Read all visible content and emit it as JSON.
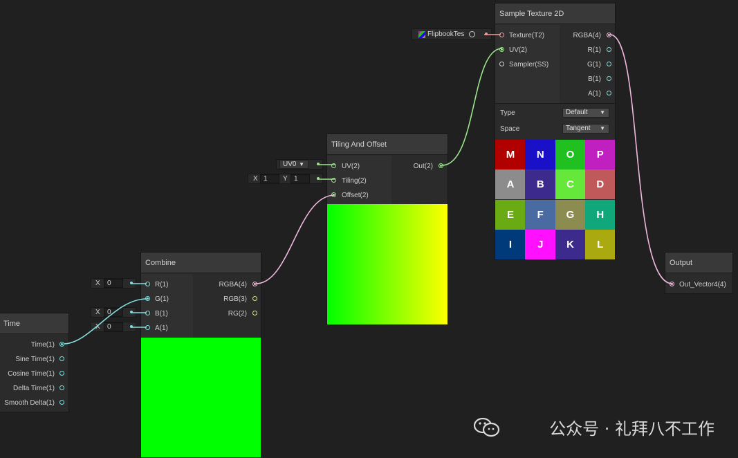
{
  "nodes": {
    "time": {
      "title": "Time",
      "outputs": [
        "Time(1)",
        "Sine Time(1)",
        "Cosine Time(1)",
        "Delta Time(1)",
        "Smooth Delta(1)"
      ]
    },
    "combine": {
      "title": "Combine",
      "inputs": [
        "R(1)",
        "G(1)",
        "B(1)",
        "A(1)"
      ],
      "outputs": [
        "RGBA(4)",
        "RGB(3)",
        "RG(2)"
      ],
      "field_axis": "X",
      "r_value": "0",
      "b_value": "0",
      "a_value": "0",
      "preview_color": "#00ff00"
    },
    "tiling": {
      "title": "Tiling And Offset",
      "inputs": [
        "UV(2)",
        "Tiling(2)",
        "Offset(2)"
      ],
      "outputs": [
        "Out(2)"
      ],
      "uv_channel": "UV0",
      "tiling_x_label": "X",
      "tiling_x": "1",
      "tiling_y_label": "Y",
      "tiling_y": "1"
    },
    "sample": {
      "title": "Sample Texture 2D",
      "inputs": [
        "Texture(T2)",
        "UV(2)",
        "Sampler(SS)"
      ],
      "outputs": [
        "RGBA(4)",
        "R(1)",
        "G(1)",
        "B(1)",
        "A(1)"
      ],
      "type_label": "Type",
      "type_value": "Default",
      "space_label": "Space",
      "space_value": "Tangent",
      "texture_asset": "FlipbookTes"
    },
    "output": {
      "title": "Output",
      "inputs": [
        "Out_Vector4(4)"
      ]
    }
  },
  "flipbook_letters": [
    "M",
    "N",
    "O",
    "P",
    "A",
    "B",
    "C",
    "D",
    "E",
    "F",
    "G",
    "H",
    "I",
    "J",
    "K",
    "L"
  ],
  "flipbook_colors": [
    "#b00000",
    "#1a10c8",
    "#20c020",
    "#c020c0",
    "#8c8c8c",
    "#3c2a8c",
    "#66e83a",
    "#c05a5a",
    "#6aaa12",
    "#4a6aa2",
    "#8c8c50",
    "#10a87a",
    "#003a7a",
    "#ff10ff",
    "#3c2a8c",
    "#aaaa10"
  ],
  "watermark": "公众号 · 礼拜八不工作"
}
